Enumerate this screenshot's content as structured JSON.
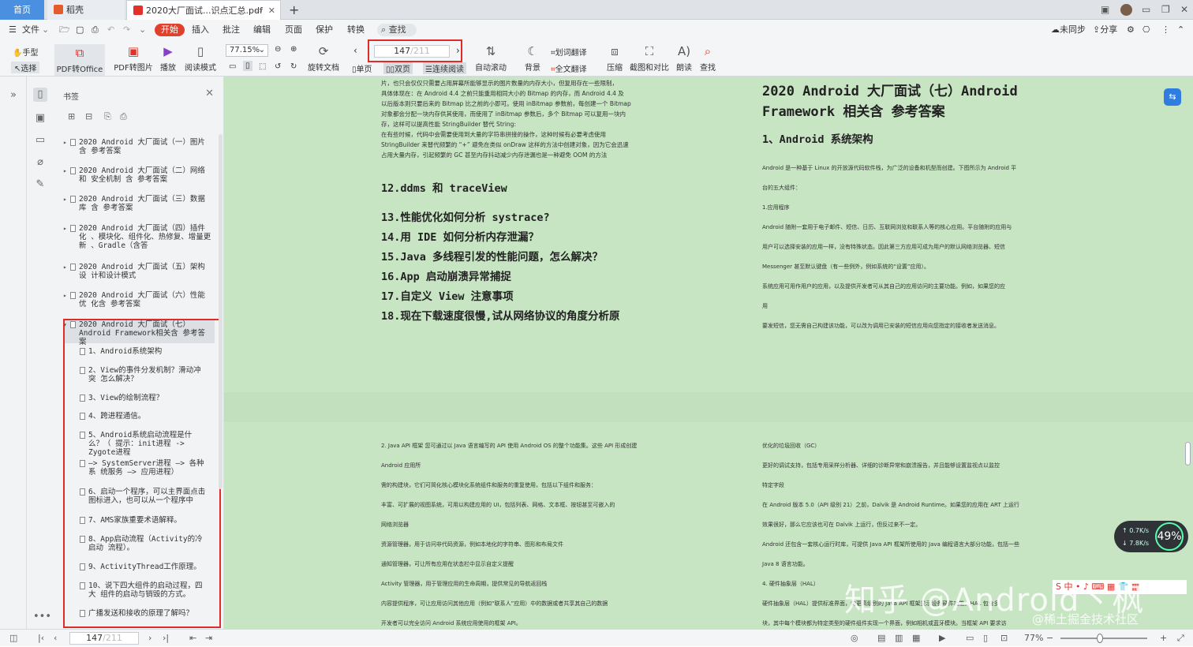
{
  "tabs": {
    "home": "首页",
    "shell": "稻壳",
    "pdf": "2020大厂面试...识点汇总.pdf"
  },
  "menu": {
    "file": "文件",
    "items": [
      "开始",
      "插入",
      "批注",
      "编辑",
      "页面",
      "保护",
      "转换"
    ],
    "search": "查找",
    "sync": "未同步",
    "share": "分享"
  },
  "toolbar": {
    "hand": "手型",
    "select": "选择",
    "pdf_to_office": "PDF转Office",
    "pdf_to_image": "PDF转图片",
    "play": "播放",
    "read_mode": "阅读模式",
    "zoom": "77.15%",
    "rotate": "旋转文档",
    "single": "单页",
    "double": "双页",
    "continuous": "连续阅读",
    "page_current": "147",
    "page_total": "/211",
    "auto_scroll": "自动滚动",
    "background": "背景",
    "word_translate": "划词翻译",
    "full_translate": "全文翻译",
    "compress": "压缩",
    "screenshot_compare": "截图和对比",
    "read_aloud": "朗读",
    "find": "查找"
  },
  "panel": {
    "title": "书签",
    "bookmarks": [
      "2020 Android 大厂面试（一）图片 含 参考答案",
      "2020 Android 大厂面试（二）网络和 安全机制 含 参考答案",
      "2020 Android 大厂面试（三）数据库 含 参考答案",
      "2020 Android 大厂面试（四）插件化 、模块化、组件化、热修复、增量更新 、Gradle（含答",
      "2020 Android 大厂面试（五）架构设 计和设计模式",
      "2020 Android 大厂面试（六）性能优 化含 参考答案",
      "2020 Android 大厂面试（七）Android Framework相关含 参考答案"
    ],
    "children": [
      "1、Android系统架构",
      "2、View的事件分发机制？滑动冲突 怎么解决？",
      "3、View的绘制流程？",
      "4、跨进程通信。",
      "5、Android系统启动流程是什么？（ 提示：init进程 -> Zygote进程",
      "–> SystemServer进程 –> 各种系 统服务 –> 应用进程）",
      "6、启动一个程序，可以主界面点击 图标进入，也可以从一个程序中",
      "7、AMS家族重要术语解释。",
      "8、App启动流程（Activity的冷启动 流程）。",
      "9、ActivityThread工作原理。",
      "10、说下四大组件的启动过程，四大 组件的启动与销毁的方式。",
      "广播发送和接收的原理了解吗？"
    ]
  },
  "doc": {
    "left_top_lines": [
      "片，也只会仅仅只需要占用屏幕所能够显示的图片数量的内存大小，但复用存在一些限制，",
      "具体体现在：在 Android 4.4 之前只能重用相同大小的 Bitmap 的内存，而 Android 4.4 及",
      "以后版本则只要后来的 Bitmap 比之前的小即可。使用 inBitmap 参数前，每创建一个 Bitmap",
      "对象都会分配一块内存供其使用，而使用了 inBitmap 参数后，多个 Bitmap 可以复用一块内",
      "存，这样可以提高性能 StringBuilder 替代 String:",
      "在有些时候，代码中会需要使用到大量的字符串拼接的操作，这种时候有必要考虑使用",
      "StringBuilder 来替代频繁的 “+” 避免在类似 onDraw 这样的方法中创建对象，因为它会迅速",
      "占用大量内存，引起频繁的 GC 甚至内存抖动减少内存泄漏也是一种避免 OOM 的方法"
    ],
    "left_headings": [
      "12.ddms 和 traceView",
      "13.性能优化如何分析 systrace?",
      "14.用 IDE 如何分析内存泄漏？",
      "15.Java 多线程引发的性能问题，怎么解决？",
      "16.App 启动崩溃异常捕捉",
      "17.自定义 View 注意事项",
      "18.现在下载速度很慢,试从网络协议的角度分析原"
    ],
    "right_title_1": "2020 Android 大厂面试（七）Android",
    "right_title_2": "Framework 相关含 参考答案",
    "right_subtitle": "1、Android 系统架构",
    "right_top_lines": [
      "Android 是一种基于 Linux 的开放源代码软件栈，为广泛的设备和机型而创建。下图所示为 Android 平",
      "台的五大组件：",
      "1.应用程序",
      "Android 随附一套用于电子邮件、短信、日历、互联网浏览和联系人等的核心应用。平台随附的应用与",
      "用户可以选择安装的应用一样，没有特殊状态。因此第三方应用可成为用户的默认网络浏览器、短信",
      "Messenger 甚至默认键盘（有一些例外，例如系统的“设置”应用）。",
      "系统应用可用作用户的应用，以及提供开发者可从其自己的应用访问的主要功能。例如，如果您的应",
      "用",
      "要发短信，您无需自己构建该功能，可以改为调用已安装的短信应用向您指定的接收者发送消息。"
    ],
    "left_bottom_lines": [
      "2. Java API 框架 您可通过以 Java 语言编写的 API 使用 Android OS 的整个功能集。这些 API 形成创建",
      "Android 应用所",
      "需的构建块，它们可简化核心模块化系统组件和服务的重复使用，包括以下组件和服务：",
      "丰富、可扩展的视图系统，可用以构建应用的 UI，包括列表、网格、文本框、按钮甚至可嵌入的",
      "网络浏览器",
      "资源管理器，用于访问非代码资源，例如本地化的字符串、图形和布局文件",
      "通知管理器，可让所有应用在状态栏中显示自定义提醒",
      "Activity 管理器，用于管理应用的生命周期，提供常见的导航返回栈",
      "内容提供程序，可让应用访问其他应用（例如“联系人”应用）中的数据或者共享其自己的数据",
      "开发者可以完全访问 Android 系统应用使用的框架 API。"
    ],
    "right_bottom_lines": [
      "优化的垃圾回收（GC）",
      "更好的调试支持，包括专用采样分析器、详细的诊断异常和崩溃报告，并且能够设置监视点以监控",
      "特定字段",
      "在 Android 版本 5.0（API 级别 21）之前，Dalvik 是 Android Runtime。如果您的应用在 ART 上运行",
      "效果很好，那么它应该也可在 Dalvik 上运行，但反过来不一定。",
      "Android 还包含一套核心运行时库，可提供 Java API 框架所使用的 Java 编程语言大部分功能，包括一些",
      "Java 8 语言功能。",
      "4. 硬件抽象层（HAL）",
      "硬件抽象层（HAL）提供标准界面，向更高级别的 Java API 框架显示设备硬件功能。HAL 包含多",
      "块，其中每个模块都为特定类型的硬件组件实现一个界面，例如相机或蓝牙模块。当框架 API 要求访"
    ]
  },
  "overlay": {
    "speed_up": "0.7K/s",
    "speed_down": "7.8K/s",
    "percent": "49%",
    "watermark": "知乎 @Android丶枫",
    "watermark_sub": "@稀土掘金技术社区"
  },
  "statusbar": {
    "page_current": "147",
    "page_total": "/211",
    "zoom": "77%"
  }
}
